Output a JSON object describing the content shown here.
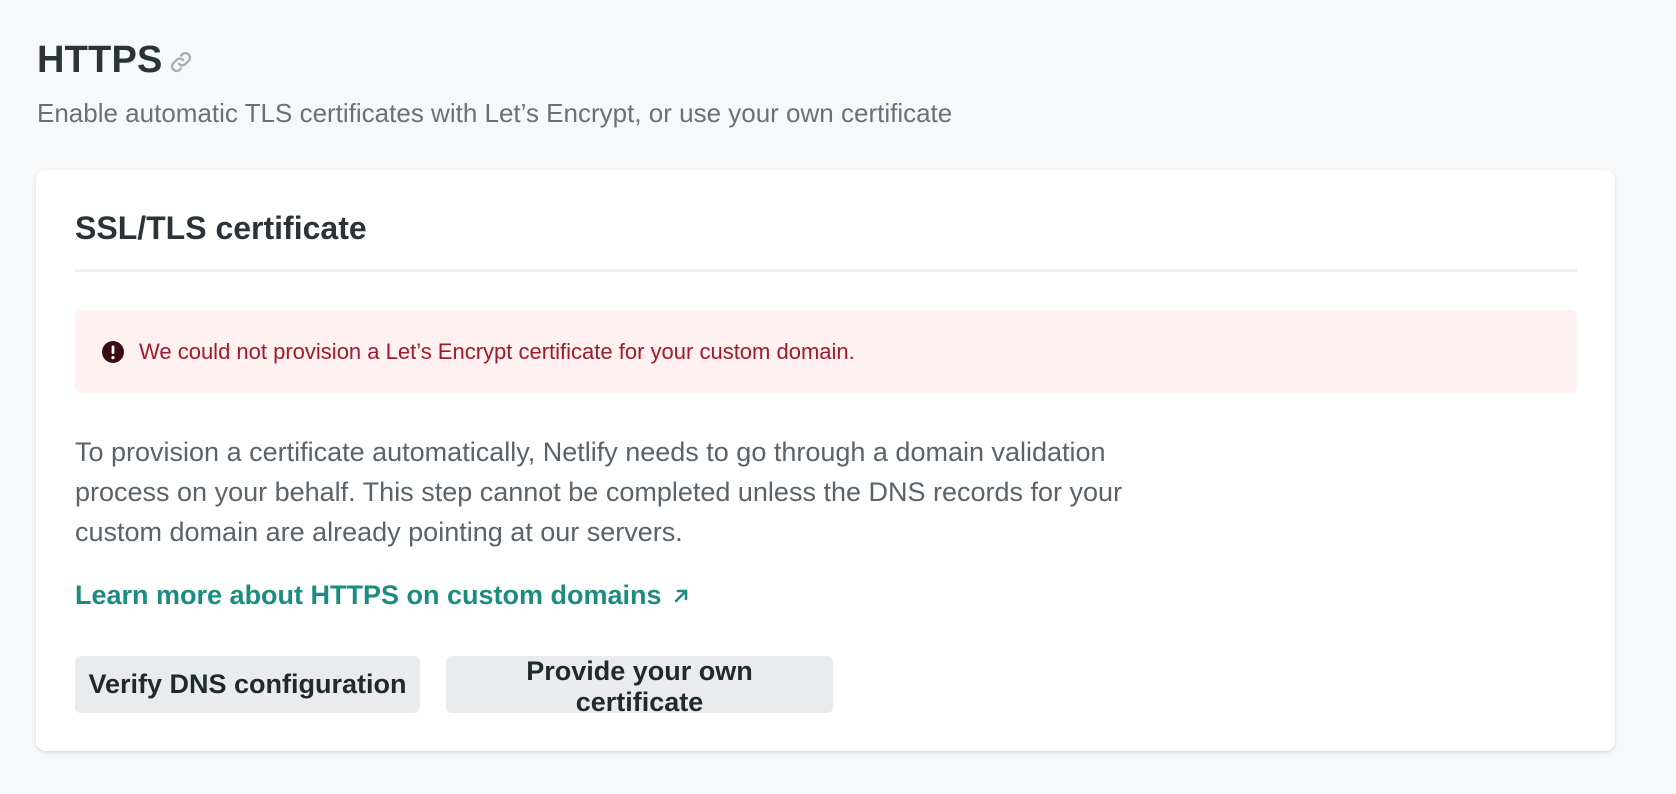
{
  "section": {
    "title": "HTTPS",
    "subtitle": "Enable automatic TLS certificates with Let’s Encrypt, or use your own certificate"
  },
  "card": {
    "title": "SSL/TLS certificate",
    "alert": {
      "text": "We could not provision a Let’s Encrypt certificate for your custom domain.",
      "icon": "exclamation-circle-icon"
    },
    "body": "To provision a certificate automatically, Netlify needs to go through a domain validation process on your behalf. This step cannot be completed unless the DNS records for your custom domain are already pointing at our servers.",
    "learn_link": {
      "label": "Learn more about HTTPS on custom domains",
      "icon": "external-arrow-icon"
    },
    "buttons": {
      "verify_label": "Verify DNS configuration",
      "provide_label": "Provide your own certificate"
    }
  },
  "colors": {
    "link": "#1b8c81",
    "alert_bg": "#fff1f2",
    "alert_text": "#a11a2c",
    "button_bg": "#e9ebec",
    "page_bg": "#f6f8f9"
  }
}
